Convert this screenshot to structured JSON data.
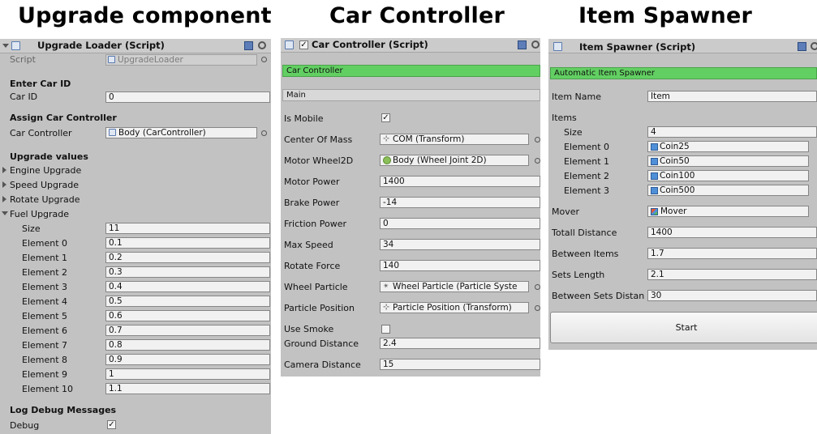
{
  "titles": {
    "upgrade": "Upgrade component",
    "car": "Car Controller",
    "spawner": "Item Spawner"
  },
  "upgrade_panel": {
    "header": "Upgrade Loader (Script)",
    "script_label": "Script",
    "script_value": "UpgradeLoader",
    "section_car_id": "Enter Car ID",
    "car_id_label": "Car ID",
    "car_id_value": "0",
    "section_assign": "Assign Car Controller",
    "car_controller_label": "Car Controller",
    "car_controller_value": "Body (CarController)",
    "section_upgrades": "Upgrade values",
    "foldouts": [
      "Engine Upgrade",
      "Speed Upgrade",
      "Rotate Upgrade",
      "Fuel Upgrade"
    ],
    "fuel": {
      "size_label": "Size",
      "size_value": "11",
      "elements": [
        {
          "label": "Element 0",
          "value": "0.1"
        },
        {
          "label": "Element 1",
          "value": "0.2"
        },
        {
          "label": "Element 2",
          "value": "0.3"
        },
        {
          "label": "Element 3",
          "value": "0.4"
        },
        {
          "label": "Element 4",
          "value": "0.5"
        },
        {
          "label": "Element 5",
          "value": "0.6"
        },
        {
          "label": "Element 6",
          "value": "0.7"
        },
        {
          "label": "Element 7",
          "value": "0.8"
        },
        {
          "label": "Element 8",
          "value": "0.9"
        },
        {
          "label": "Element 9",
          "value": "1"
        },
        {
          "label": "Element 10",
          "value": "1.1"
        }
      ]
    },
    "section_debug": "Log Debug Messages",
    "debug_label": "Debug",
    "debug_checked": true
  },
  "car_panel": {
    "header": "Car Controller (Script)",
    "green_label": "Car Controller",
    "main_label": "Main",
    "is_mobile_label": "Is Mobile",
    "is_mobile_checked": true,
    "rows": [
      {
        "label": "Center Of Mass",
        "value": "COM (Transform)",
        "icon": "transform-icon"
      },
      {
        "label": "Motor Wheel2D",
        "value": "Body (Wheel Joint 2D)",
        "icon": "wheel-joint-icon"
      },
      {
        "label": "Motor Power",
        "value": "1400"
      },
      {
        "label": "Brake Power",
        "value": "-14"
      },
      {
        "label": "Friction Power",
        "value": "0"
      },
      {
        "label": "Max Speed",
        "value": "34"
      },
      {
        "label": "Rotate Force",
        "value": "140"
      },
      {
        "label": "Wheel Particle",
        "value": "Wheel Particle (Particle Syste",
        "icon": "particle-icon"
      },
      {
        "label": "Particle Position",
        "value": "Particle Position (Transform)",
        "icon": "transform-icon"
      }
    ],
    "use_smoke_label": "Use Smoke",
    "use_smoke_checked": false,
    "ground_distance_label": "Ground Distance",
    "ground_distance_value": "2.4",
    "camera_distance_label": "Camera Distance",
    "camera_distance_value": "15"
  },
  "spawner_panel": {
    "header": "Item Spawner (Script)",
    "green_label": "Automatic Item Spawner",
    "item_name_label": "Item Name",
    "item_name_value": "Item",
    "items_label": "Items",
    "size_label": "Size",
    "size_value": "4",
    "elements": [
      {
        "label": "Element 0",
        "value": "Coin25"
      },
      {
        "label": "Element 1",
        "value": "Coin50"
      },
      {
        "label": "Element 2",
        "value": "Coin100"
      },
      {
        "label": "Element 3",
        "value": "Coin500"
      }
    ],
    "mover_label": "Mover",
    "mover_value": "Mover",
    "rows": [
      {
        "label": "Totall Distance",
        "value": "1400"
      },
      {
        "label": "Between Items",
        "value": "1.7"
      },
      {
        "label": "Sets Length",
        "value": "2.1"
      },
      {
        "label": "Between Sets Distan",
        "value": "30"
      }
    ],
    "start_label": "Start"
  }
}
